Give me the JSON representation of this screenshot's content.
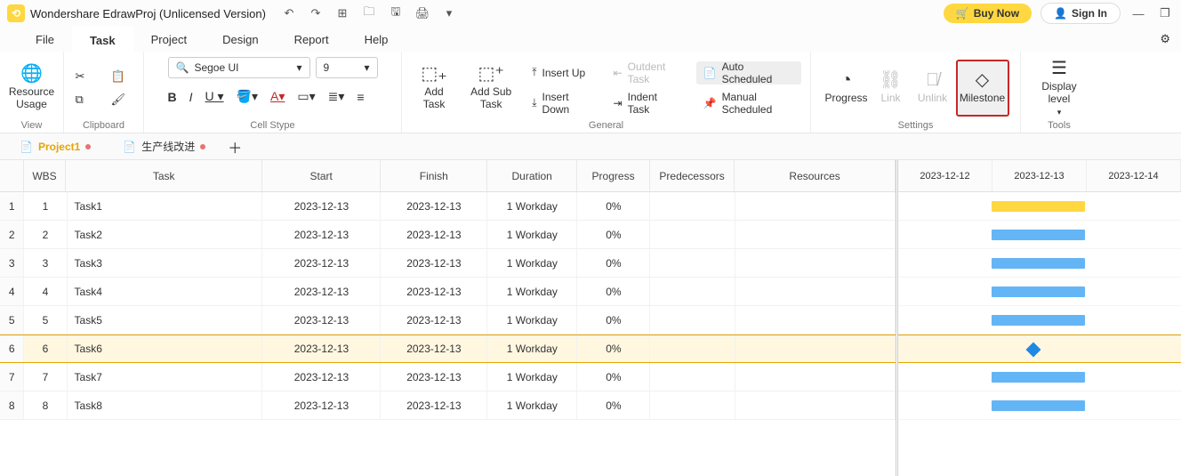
{
  "titlebar": {
    "app_title": "Wondershare EdrawProj (Unlicensed Version)",
    "buy_now": "Buy Now",
    "sign_in": "Sign In"
  },
  "menu": {
    "items": [
      "File",
      "Task",
      "Project",
      "Design",
      "Report",
      "Help"
    ],
    "active_index": 1
  },
  "ribbon": {
    "view": {
      "resource_usage": "Resource\nUsage",
      "label": "View"
    },
    "clipboard": {
      "label": "Clipboard"
    },
    "cell": {
      "font_name": "Segoe UI",
      "font_size": "9",
      "label": "Cell Stype"
    },
    "general": {
      "add_task": "Add\nTask",
      "add_sub": "Add Sub\nTask",
      "insert_up": "Insert Up",
      "insert_down": "Insert Down",
      "outdent": "Outdent Task",
      "indent": "Indent Task",
      "auto": "Auto Scheduled",
      "manual": "Manual Scheduled",
      "label": "General"
    },
    "settings": {
      "progress": "Progress",
      "link": "Link",
      "unlink": "Unlink",
      "milestone": "Milestone",
      "label": "Settings"
    },
    "tools": {
      "display_level": "Display\nlevel",
      "label": "Tools"
    }
  },
  "doctabs": {
    "tabs": [
      {
        "name": "Project1",
        "active": true
      },
      {
        "name": "生产线改进",
        "active": false
      }
    ]
  },
  "grid": {
    "headers": {
      "wbs": "WBS",
      "task": "Task",
      "start": "Start",
      "finish": "Finish",
      "duration": "Duration",
      "progress": "Progress",
      "predecessors": "Predecessors",
      "resources": "Resources"
    },
    "rows": [
      {
        "idx": "1",
        "wbs": "1",
        "task": "Task1",
        "start": "2023-12-13",
        "finish": "2023-12-13",
        "dur": "1 Workday",
        "prog": "0%",
        "selected": false,
        "bar": "yellow"
      },
      {
        "idx": "2",
        "wbs": "2",
        "task": "Task2",
        "start": "2023-12-13",
        "finish": "2023-12-13",
        "dur": "1 Workday",
        "prog": "0%",
        "selected": false,
        "bar": "blue"
      },
      {
        "idx": "3",
        "wbs": "3",
        "task": "Task3",
        "start": "2023-12-13",
        "finish": "2023-12-13",
        "dur": "1 Workday",
        "prog": "0%",
        "selected": false,
        "bar": "blue"
      },
      {
        "idx": "4",
        "wbs": "4",
        "task": "Task4",
        "start": "2023-12-13",
        "finish": "2023-12-13",
        "dur": "1 Workday",
        "prog": "0%",
        "selected": false,
        "bar": "blue"
      },
      {
        "idx": "5",
        "wbs": "5",
        "task": "Task5",
        "start": "2023-12-13",
        "finish": "2023-12-13",
        "dur": "1 Workday",
        "prog": "0%",
        "selected": false,
        "bar": "blue"
      },
      {
        "idx": "6",
        "wbs": "6",
        "task": "Task6",
        "start": "2023-12-13",
        "finish": "2023-12-13",
        "dur": "1 Workday",
        "prog": "0%",
        "selected": true,
        "bar": "diamond"
      },
      {
        "idx": "7",
        "wbs": "7",
        "task": "Task7",
        "start": "2023-12-13",
        "finish": "2023-12-13",
        "dur": "1 Workday",
        "prog": "0%",
        "selected": false,
        "bar": "blue"
      },
      {
        "idx": "8",
        "wbs": "8",
        "task": "Task8",
        "start": "2023-12-13",
        "finish": "2023-12-13",
        "dur": "1 Workday",
        "prog": "0%",
        "selected": false,
        "bar": "blue"
      }
    ]
  },
  "gantt": {
    "days": [
      "2023-12-12",
      "2023-12-13",
      "2023-12-14"
    ]
  }
}
